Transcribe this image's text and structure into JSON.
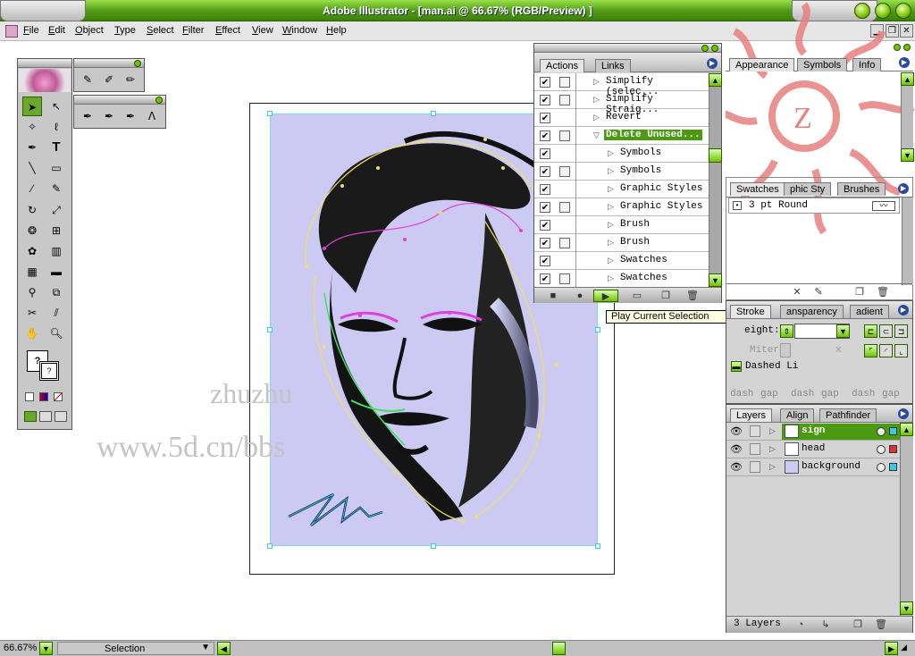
{
  "window": {
    "title": "Adobe Illustrator - [man.ai @ 66.67% (RGB/Preview) ]"
  },
  "menu": [
    {
      "label": "File",
      "u": "F",
      "rest": "ile"
    },
    {
      "label": "Edit",
      "u": "E",
      "rest": "dit"
    },
    {
      "label": "Object",
      "u": "O",
      "rest": "bject"
    },
    {
      "label": "Type",
      "u": "T",
      "rest": "ype"
    },
    {
      "label": "Select",
      "u": "S",
      "rest": "elect"
    },
    {
      "label": "Filter",
      "u": "F",
      "rest": "ilter"
    },
    {
      "label": "Effect",
      "u": "E",
      "rest": "ffect"
    },
    {
      "label": "View",
      "u": "V",
      "rest": "iew"
    },
    {
      "label": "Window",
      "u": "W",
      "rest": "indow"
    },
    {
      "label": "Help",
      "u": "H",
      "rest": "elp"
    }
  ],
  "watermark": {
    "line1": "zhuzhu",
    "line2": "www.5d.cn/bbs"
  },
  "actions_panel": {
    "tabs": [
      "Actions",
      "Links"
    ],
    "rows": [
      {
        "label": "Simplify (selec...",
        "indent": 0,
        "dialog": true,
        "highlight": false
      },
      {
        "label": "Simplify Straig...",
        "indent": 0,
        "dialog": true,
        "highlight": false
      },
      {
        "label": "Revert",
        "indent": 0,
        "dialog": false,
        "highlight": false
      },
      {
        "label": "Delete Unused...",
        "indent": 0,
        "dialog": true,
        "highlight": true,
        "open": true
      },
      {
        "label": "Symbols",
        "indent": 1,
        "dialog": false,
        "highlight": false
      },
      {
        "label": "Symbols",
        "indent": 1,
        "dialog": true,
        "highlight": false
      },
      {
        "label": "Graphic Styles",
        "indent": 1,
        "dialog": false,
        "highlight": false
      },
      {
        "label": "Graphic Styles",
        "indent": 1,
        "dialog": true,
        "highlight": false
      },
      {
        "label": "Brush",
        "indent": 1,
        "dialog": false,
        "highlight": false
      },
      {
        "label": "Brush",
        "indent": 1,
        "dialog": true,
        "highlight": false
      },
      {
        "label": "Swatches",
        "indent": 1,
        "dialog": false,
        "highlight": false
      },
      {
        "label": "Swatches",
        "indent": 1,
        "dialog": true,
        "highlight": false
      }
    ]
  },
  "tooltip": "Play Current Selection",
  "appearance_panel": {
    "tabs": [
      "Appearance",
      "Symbols",
      "Info"
    ]
  },
  "swatches_panel": {
    "tabs": [
      "Swatches",
      "phic Sty",
      "Brushes"
    ],
    "brush_item": "3 pt Round"
  },
  "stroke_panel": {
    "tabs": [
      "Stroke",
      "ansparency",
      "adient"
    ],
    "weight_label": "eight:",
    "miter_label": "Miter",
    "miter_x": "x",
    "dashed_label": "Dashed Li",
    "dash_labels": [
      "dash",
      "gap",
      "dash",
      "gap",
      "dash",
      "gap"
    ]
  },
  "layers_panel": {
    "tabs": [
      "Layers",
      "Align",
      "Pathfinder"
    ],
    "layers": [
      {
        "name": "sign",
        "color": "#38c8e8",
        "selected": true
      },
      {
        "name": "head",
        "color": "#e03040",
        "selected": false
      },
      {
        "name": "background",
        "color": "#38c8e8",
        "selected": false
      }
    ],
    "count": "3 Layers"
  },
  "status": {
    "zoom": "66.67%",
    "mode": "Selection"
  }
}
